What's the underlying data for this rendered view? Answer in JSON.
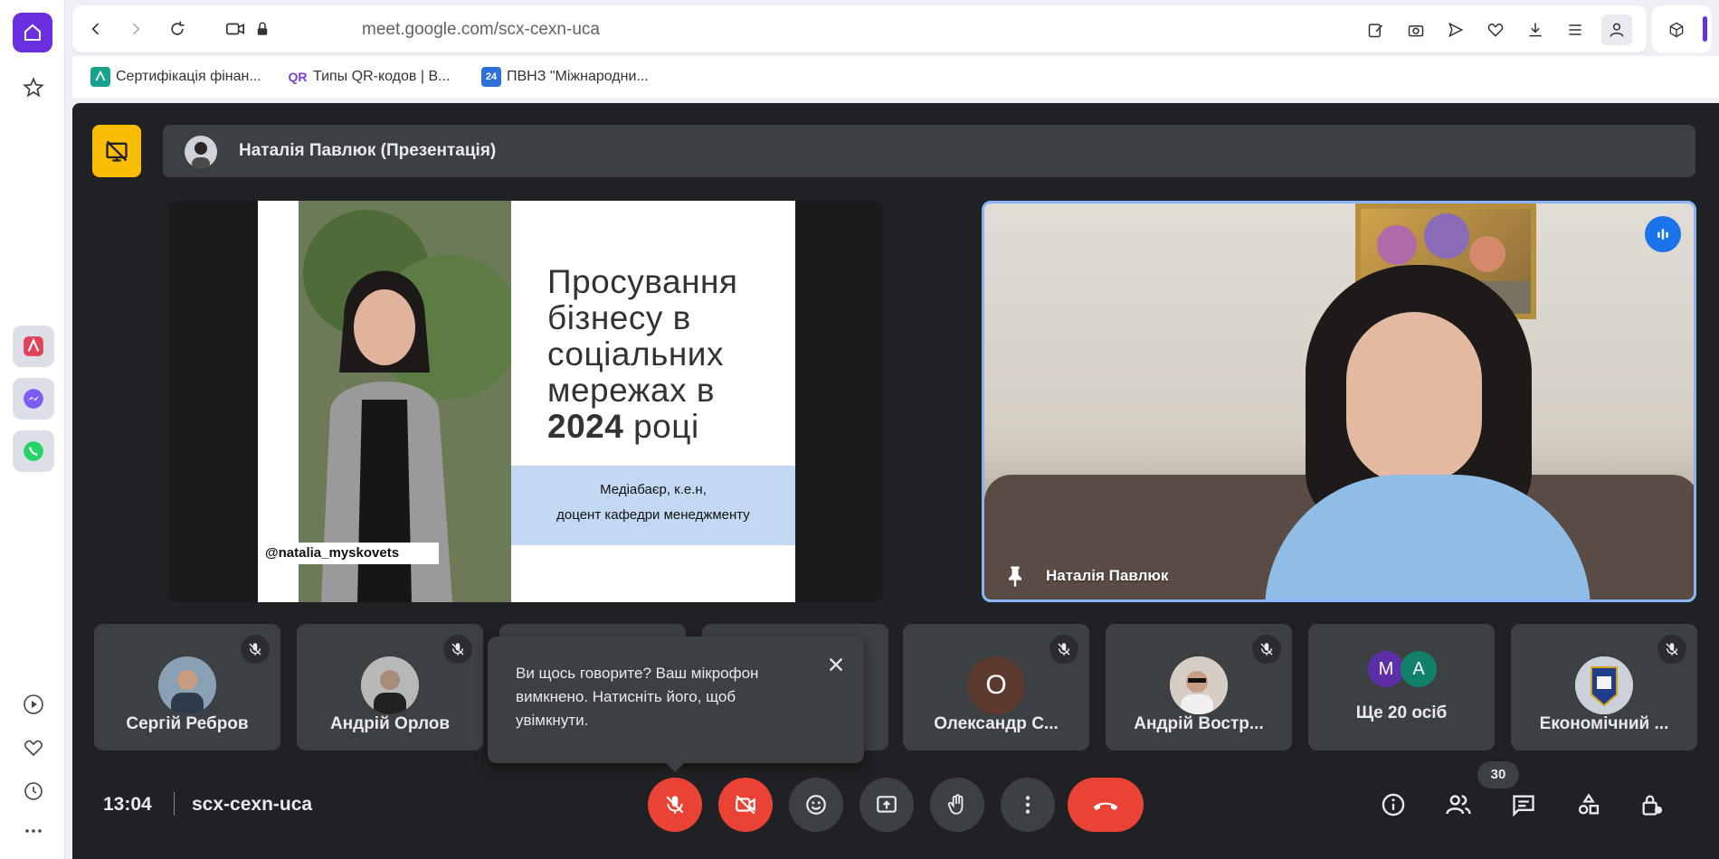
{
  "browser": {
    "url": "meet.google.com/scx-cexn-uca",
    "bookmarks": [
      {
        "label": "Сертифікація фінан..."
      },
      {
        "label": "Типы QR-кодов | В..."
      },
      {
        "label": "ПВНЗ \"Міжнародни..."
      }
    ],
    "bookmark_icon_text": [
      "QR",
      "24"
    ]
  },
  "meet": {
    "presentation_title": "Наталія Павлюк (Презентація)",
    "slide": {
      "title_lines": [
        "Просування",
        "бізнесу в",
        "соціальних",
        "мережах в"
      ],
      "year": "2024",
      "year_suffix": " році",
      "subtitle_line1": "Медіабаєр, к.е.н,",
      "subtitle_line2": "доцент кафедри менеджменту",
      "handle": "@natalia_myskovets"
    },
    "speaker_name": "Наталія Павлюк",
    "participants": [
      {
        "name": "Сергій Ребров"
      },
      {
        "name": "Андрій Орлов"
      },
      {
        "name": ""
      },
      {
        "name": ""
      },
      {
        "name": "Олександр С...",
        "initial": "О"
      },
      {
        "name": "Андрій Востр..."
      },
      {
        "name": "Ще 20 осіб",
        "initials": [
          "М",
          "А"
        ]
      },
      {
        "name": "Економічний ..."
      }
    ],
    "tooltip": {
      "text": "Ви щось говорите? Ваш мікрофон вимкнено. Натисніть його, щоб увімкнути."
    },
    "clock": "13:04",
    "meeting_code": "scx-cexn-uca",
    "participant_count": "30",
    "colors": {
      "background": "#202124",
      "tile": "#3c4043",
      "danger": "#ea4335",
      "accent": "#8ab4f8",
      "present_badge": "#fbbc04"
    }
  }
}
